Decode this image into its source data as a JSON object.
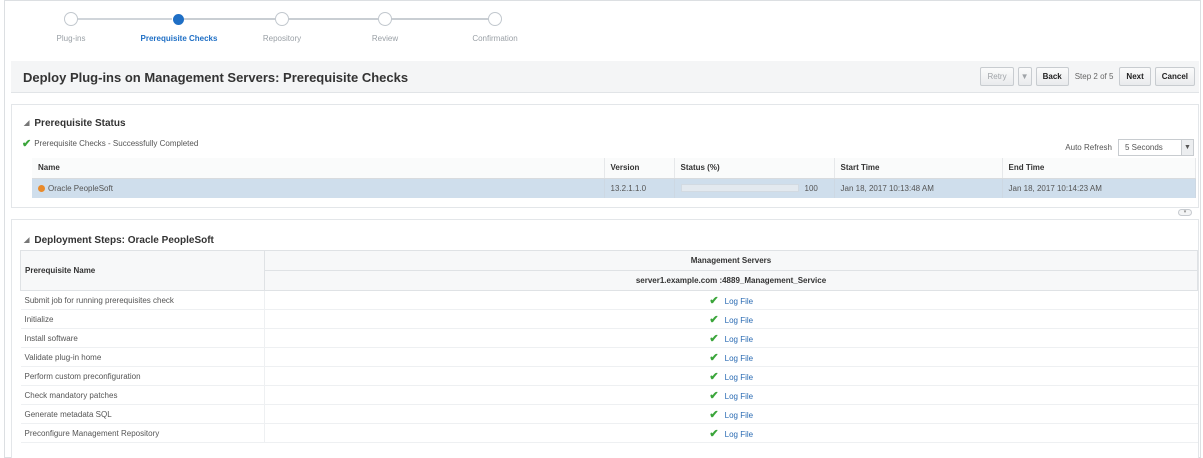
{
  "train": {
    "steps": [
      {
        "label": "Plug-ins",
        "state": "visited"
      },
      {
        "label": "Prerequisite Checks",
        "state": "current"
      },
      {
        "label": "Repository",
        "state": "upcoming"
      },
      {
        "label": "Review",
        "state": "upcoming"
      },
      {
        "label": "Confirmation",
        "state": "upcoming"
      }
    ]
  },
  "header": {
    "title": "Deploy Plug-ins on Management Servers: Prerequisite Checks",
    "retry_label": "Retry",
    "back_label": "Back",
    "step_text": "Step 2 of 5",
    "next_label": "Next",
    "cancel_label": "Cancel"
  },
  "status_panel": {
    "title": "Prerequisite Status",
    "summary": "Prerequisite Checks -  Successfully Completed",
    "auto_refresh_label": "Auto Refresh",
    "auto_refresh_value": "5 Seconds",
    "columns": [
      "Name",
      "Version",
      "Status (%)",
      "Start Time",
      "End Time"
    ],
    "rows": [
      {
        "name": "Oracle PeopleSoft",
        "version": "13.2.1.1.0",
        "status_percent": "100",
        "start_time": "Jan 18, 2017 10:13:48 AM",
        "end_time": "Jan 18, 2017 10:14:23 AM"
      }
    ]
  },
  "steps_panel": {
    "title": "Deployment Steps: Oracle PeopleSoft",
    "col_prereq": "Prerequisite Name",
    "col_group": "Management Servers",
    "col_server": "server1.example.com :4889_Management_Service",
    "log_label": "Log File",
    "rows": [
      {
        "name": "Submit job for running prerequisites check"
      },
      {
        "name": "Initialize"
      },
      {
        "name": "Install software"
      },
      {
        "name": "Validate plug-in home"
      },
      {
        "name": "Perform custom preconfiguration"
      },
      {
        "name": "Check mandatory patches"
      },
      {
        "name": "Generate metadata SQL"
      },
      {
        "name": "Preconfigure Management Repository"
      }
    ]
  },
  "colors": {
    "accent": "#1f6fc5",
    "success": "#3aa53a",
    "selected_row": "#cfdeec",
    "link": "#2a6bb3"
  }
}
